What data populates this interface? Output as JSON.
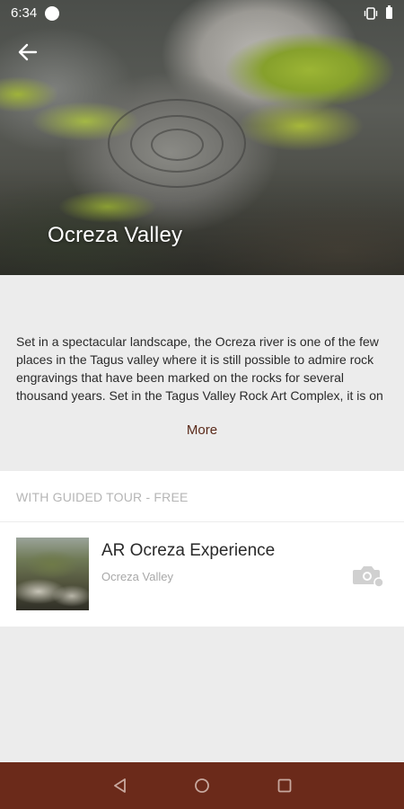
{
  "status_bar": {
    "time": "6:34"
  },
  "header": {
    "title": "Ocreza Valley"
  },
  "description": {
    "text": "Set in a spectacular landscape, the Ocreza river is one of the few places in the Tagus valley where it is still possible to admire rock engravings that have been marked on the rocks for several thousand years. Set in the Tagus Valley Rock Art Complex, it is on the Ocreza river that we find the oldest en…",
    "more_label": "More"
  },
  "tours": {
    "section_header": "WITH GUIDED TOUR - FREE",
    "items": [
      {
        "title": "AR Ocreza Experience",
        "subtitle": "Ocreza Valley",
        "icon": "camera-icon"
      }
    ]
  },
  "colors": {
    "accent": "#6b2a1a",
    "more_link": "#5a2a1a",
    "background": "#ececec"
  }
}
